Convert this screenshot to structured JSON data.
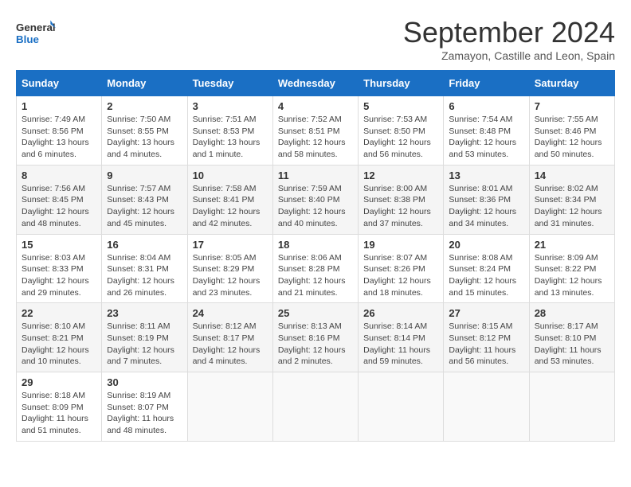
{
  "logo": {
    "general": "General",
    "blue": "Blue"
  },
  "title": "September 2024",
  "location": "Zamayon, Castille and Leon, Spain",
  "days_of_week": [
    "Sunday",
    "Monday",
    "Tuesday",
    "Wednesday",
    "Thursday",
    "Friday",
    "Saturday"
  ],
  "weeks": [
    [
      {
        "day": "1",
        "sunrise": "7:49 AM",
        "sunset": "8:56 PM",
        "daylight": "13 hours and 6 minutes."
      },
      {
        "day": "2",
        "sunrise": "7:50 AM",
        "sunset": "8:55 PM",
        "daylight": "13 hours and 4 minutes."
      },
      {
        "day": "3",
        "sunrise": "7:51 AM",
        "sunset": "8:53 PM",
        "daylight": "13 hours and 1 minute."
      },
      {
        "day": "4",
        "sunrise": "7:52 AM",
        "sunset": "8:51 PM",
        "daylight": "12 hours and 58 minutes."
      },
      {
        "day": "5",
        "sunrise": "7:53 AM",
        "sunset": "8:50 PM",
        "daylight": "12 hours and 56 minutes."
      },
      {
        "day": "6",
        "sunrise": "7:54 AM",
        "sunset": "8:48 PM",
        "daylight": "12 hours and 53 minutes."
      },
      {
        "day": "7",
        "sunrise": "7:55 AM",
        "sunset": "8:46 PM",
        "daylight": "12 hours and 50 minutes."
      }
    ],
    [
      {
        "day": "8",
        "sunrise": "7:56 AM",
        "sunset": "8:45 PM",
        "daylight": "12 hours and 48 minutes."
      },
      {
        "day": "9",
        "sunrise": "7:57 AM",
        "sunset": "8:43 PM",
        "daylight": "12 hours and 45 minutes."
      },
      {
        "day": "10",
        "sunrise": "7:58 AM",
        "sunset": "8:41 PM",
        "daylight": "12 hours and 42 minutes."
      },
      {
        "day": "11",
        "sunrise": "7:59 AM",
        "sunset": "8:40 PM",
        "daylight": "12 hours and 40 minutes."
      },
      {
        "day": "12",
        "sunrise": "8:00 AM",
        "sunset": "8:38 PM",
        "daylight": "12 hours and 37 minutes."
      },
      {
        "day": "13",
        "sunrise": "8:01 AM",
        "sunset": "8:36 PM",
        "daylight": "12 hours and 34 minutes."
      },
      {
        "day": "14",
        "sunrise": "8:02 AM",
        "sunset": "8:34 PM",
        "daylight": "12 hours and 31 minutes."
      }
    ],
    [
      {
        "day": "15",
        "sunrise": "8:03 AM",
        "sunset": "8:33 PM",
        "daylight": "12 hours and 29 minutes."
      },
      {
        "day": "16",
        "sunrise": "8:04 AM",
        "sunset": "8:31 PM",
        "daylight": "12 hours and 26 minutes."
      },
      {
        "day": "17",
        "sunrise": "8:05 AM",
        "sunset": "8:29 PM",
        "daylight": "12 hours and 23 minutes."
      },
      {
        "day": "18",
        "sunrise": "8:06 AM",
        "sunset": "8:28 PM",
        "daylight": "12 hours and 21 minutes."
      },
      {
        "day": "19",
        "sunrise": "8:07 AM",
        "sunset": "8:26 PM",
        "daylight": "12 hours and 18 minutes."
      },
      {
        "day": "20",
        "sunrise": "8:08 AM",
        "sunset": "8:24 PM",
        "daylight": "12 hours and 15 minutes."
      },
      {
        "day": "21",
        "sunrise": "8:09 AM",
        "sunset": "8:22 PM",
        "daylight": "12 hours and 13 minutes."
      }
    ],
    [
      {
        "day": "22",
        "sunrise": "8:10 AM",
        "sunset": "8:21 PM",
        "daylight": "12 hours and 10 minutes."
      },
      {
        "day": "23",
        "sunrise": "8:11 AM",
        "sunset": "8:19 PM",
        "daylight": "12 hours and 7 minutes."
      },
      {
        "day": "24",
        "sunrise": "8:12 AM",
        "sunset": "8:17 PM",
        "daylight": "12 hours and 4 minutes."
      },
      {
        "day": "25",
        "sunrise": "8:13 AM",
        "sunset": "8:16 PM",
        "daylight": "12 hours and 2 minutes."
      },
      {
        "day": "26",
        "sunrise": "8:14 AM",
        "sunset": "8:14 PM",
        "daylight": "11 hours and 59 minutes."
      },
      {
        "day": "27",
        "sunrise": "8:15 AM",
        "sunset": "8:12 PM",
        "daylight": "11 hours and 56 minutes."
      },
      {
        "day": "28",
        "sunrise": "8:17 AM",
        "sunset": "8:10 PM",
        "daylight": "11 hours and 53 minutes."
      }
    ],
    [
      {
        "day": "29",
        "sunrise": "8:18 AM",
        "sunset": "8:09 PM",
        "daylight": "11 hours and 51 minutes."
      },
      {
        "day": "30",
        "sunrise": "8:19 AM",
        "sunset": "8:07 PM",
        "daylight": "11 hours and 48 minutes."
      },
      null,
      null,
      null,
      null,
      null
    ]
  ]
}
